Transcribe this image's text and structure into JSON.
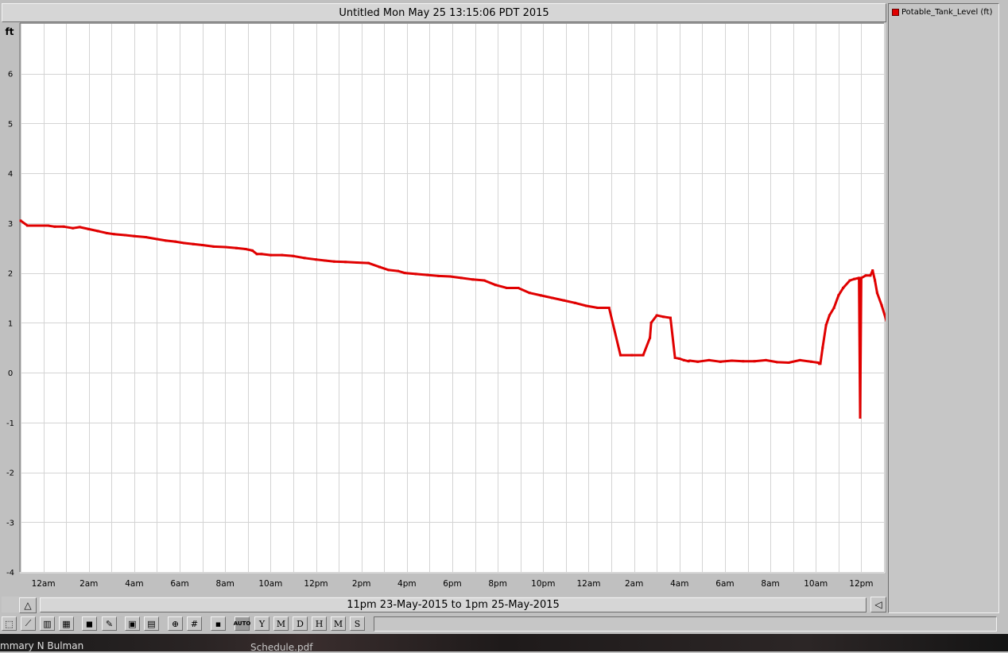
{
  "window": {
    "title": "Untitled Mon May 25 13:15:06 PDT 2015",
    "range_label": "11pm 23-May-2015 to 1pm 25-May-2015"
  },
  "legend": {
    "items": [
      {
        "label": "Potable_Tank_Level (ft)",
        "color": "#e00000"
      }
    ]
  },
  "toolbar": {
    "buttons": [
      {
        "name": "plot-type-line-icon",
        "glyph": "⬚"
      },
      {
        "name": "plot-type-area-icon",
        "glyph": "⟋"
      },
      {
        "name": "plot-type-bar-icon",
        "glyph": "▥"
      },
      {
        "name": "plot-type-table-icon",
        "glyph": "▦"
      },
      {
        "name": "cube-icon",
        "glyph": "◼"
      },
      {
        "name": "brush-icon",
        "glyph": "✎"
      },
      {
        "name": "copy-icon",
        "glyph": "▣"
      },
      {
        "name": "paste-icon",
        "glyph": "▤"
      },
      {
        "name": "zoom-icon",
        "glyph": "⊕"
      },
      {
        "name": "grid-icon",
        "glyph": "#"
      },
      {
        "name": "save-icon",
        "glyph": "▪"
      },
      {
        "name": "auto-scale-button",
        "glyph": "AUTO"
      },
      {
        "name": "year-button",
        "glyph": "Y"
      },
      {
        "name": "month-button",
        "glyph": "M"
      },
      {
        "name": "day-button",
        "glyph": "D"
      },
      {
        "name": "hour-button",
        "glyph": "H"
      },
      {
        "name": "minute-button",
        "glyph": "M"
      },
      {
        "name": "second-button",
        "glyph": "S"
      }
    ]
  },
  "taskbar": {
    "left_text": "mmary N Bulman",
    "mid_text": "Schedule.pdf"
  },
  "chart_data": {
    "type": "line",
    "title": "",
    "ylabel": "ft",
    "xlabel": "",
    "ylim": [
      -4,
      7
    ],
    "yticks": [
      -4,
      -3,
      -2,
      -1,
      0,
      1,
      2,
      3,
      4,
      5,
      6
    ],
    "x_unit": "hours since 11pm 23-May-2015",
    "xlim": [
      0,
      38
    ],
    "xticks": [
      {
        "x": 1,
        "label": "12am"
      },
      {
        "x": 3,
        "label": "2am"
      },
      {
        "x": 5,
        "label": "4am"
      },
      {
        "x": 7,
        "label": "6am"
      },
      {
        "x": 9,
        "label": "8am"
      },
      {
        "x": 11,
        "label": "10am"
      },
      {
        "x": 13,
        "label": "12pm"
      },
      {
        "x": 15,
        "label": "2pm"
      },
      {
        "x": 17,
        "label": "4pm"
      },
      {
        "x": 19,
        "label": "6pm"
      },
      {
        "x": 21,
        "label": "8pm"
      },
      {
        "x": 23,
        "label": "10pm"
      },
      {
        "x": 25,
        "label": "12am"
      },
      {
        "x": 27,
        "label": "2am"
      },
      {
        "x": 29,
        "label": "4am"
      },
      {
        "x": 31,
        "label": "6am"
      },
      {
        "x": 33,
        "label": "8am"
      },
      {
        "x": 35,
        "label": "10am"
      },
      {
        "x": 37,
        "label": "12pm"
      }
    ],
    "grid": true,
    "legend_position": "right-panel",
    "series": [
      {
        "name": "Potable_Tank_Level",
        "color": "#e00000",
        "x": [
          0.0,
          0.3,
          0.8,
          1.2,
          1.5,
          1.9,
          2.3,
          2.6,
          3.0,
          3.4,
          3.8,
          4.1,
          4.6,
          5.0,
          5.5,
          6.0,
          6.4,
          6.8,
          7.2,
          7.6,
          8.0,
          8.5,
          9.0,
          9.5,
          9.9,
          10.2,
          10.4,
          10.6,
          11.0,
          11.5,
          12.0,
          12.5,
          13.0,
          13.4,
          13.8,
          14.3,
          14.8,
          15.3,
          15.8,
          16.2,
          16.6,
          16.9,
          17.4,
          17.9,
          18.4,
          18.9,
          19.4,
          19.9,
          20.4,
          20.9,
          21.4,
          21.9,
          22.4,
          22.9,
          23.4,
          23.9,
          24.4,
          24.9,
          25.4,
          25.9,
          26.4,
          26.9,
          27.4,
          27.7,
          27.75,
          28.0,
          28.3,
          28.6,
          28.8,
          29.0,
          29.2,
          29.4,
          29.45,
          29.8,
          30.3,
          30.8,
          31.3,
          31.8,
          32.3,
          32.8,
          33.3,
          33.8,
          34.3,
          34.8,
          35.1,
          35.15,
          35.2,
          35.3,
          35.45,
          35.6,
          35.8,
          36.0,
          36.2,
          36.5,
          36.7,
          36.9,
          36.95,
          37.0,
          37.2,
          37.4,
          37.5,
          37.6,
          37.7,
          37.9,
          38.1
        ],
        "y": [
          3.05,
          2.95,
          2.95,
          2.95,
          2.93,
          2.93,
          2.9,
          2.92,
          2.88,
          2.84,
          2.8,
          2.78,
          2.76,
          2.74,
          2.72,
          2.68,
          2.65,
          2.63,
          2.6,
          2.58,
          2.56,
          2.53,
          2.52,
          2.5,
          2.48,
          2.45,
          2.38,
          2.38,
          2.36,
          2.36,
          2.34,
          2.3,
          2.27,
          2.25,
          2.23,
          2.22,
          2.21,
          2.2,
          2.12,
          2.06,
          2.04,
          2.0,
          1.98,
          1.96,
          1.94,
          1.93,
          1.9,
          1.87,
          1.85,
          1.76,
          1.7,
          1.7,
          1.6,
          1.55,
          1.5,
          1.45,
          1.4,
          1.34,
          1.3,
          1.3,
          0.35,
          0.35,
          0.35,
          0.7,
          1.0,
          1.15,
          1.12,
          1.1,
          0.3,
          0.28,
          0.25,
          0.23,
          0.24,
          0.22,
          0.25,
          0.22,
          0.24,
          0.23,
          0.23,
          0.25,
          0.21,
          0.2,
          0.25,
          0.22,
          0.2,
          0.18,
          0.18,
          0.5,
          0.95,
          1.15,
          1.3,
          1.55,
          1.7,
          1.85,
          1.88,
          1.9,
          -0.9,
          1.9,
          1.95,
          1.95,
          2.05,
          1.85,
          1.6,
          1.35,
          1.05
        ]
      }
    ]
  }
}
